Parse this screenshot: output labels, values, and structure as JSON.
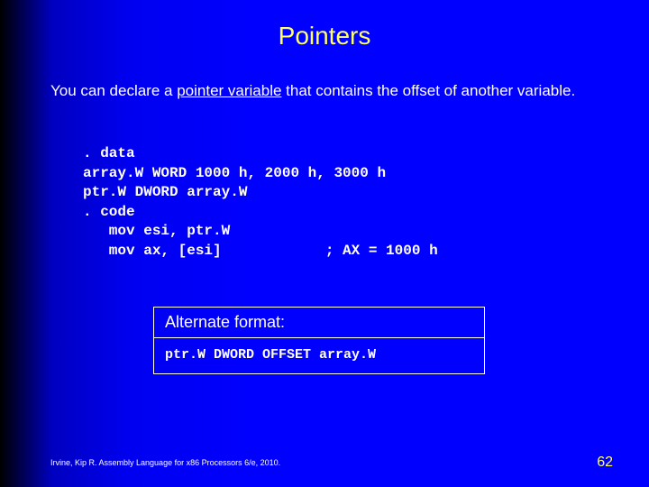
{
  "title": "Pointers",
  "body": {
    "pre": "You can declare a ",
    "underlined": "pointer variable",
    "post": " that contains the offset of another variable."
  },
  "code": {
    "l1": ". data",
    "l2": "array.W WORD 1000 h, 2000 h, 3000 h",
    "l3": "ptr.W DWORD array.W",
    "l4": ". code",
    "l5": "   mov esi, ptr.W",
    "l6": "   mov ax, [esi]            ; AX = 1000 h"
  },
  "altbox": {
    "title": "Alternate format:",
    "code": "ptr.W DWORD OFFSET array.W"
  },
  "footer": {
    "citation": "Irvine, Kip R. Assembly Language for x86 Processors 6/e, 2010.",
    "page": "62"
  }
}
